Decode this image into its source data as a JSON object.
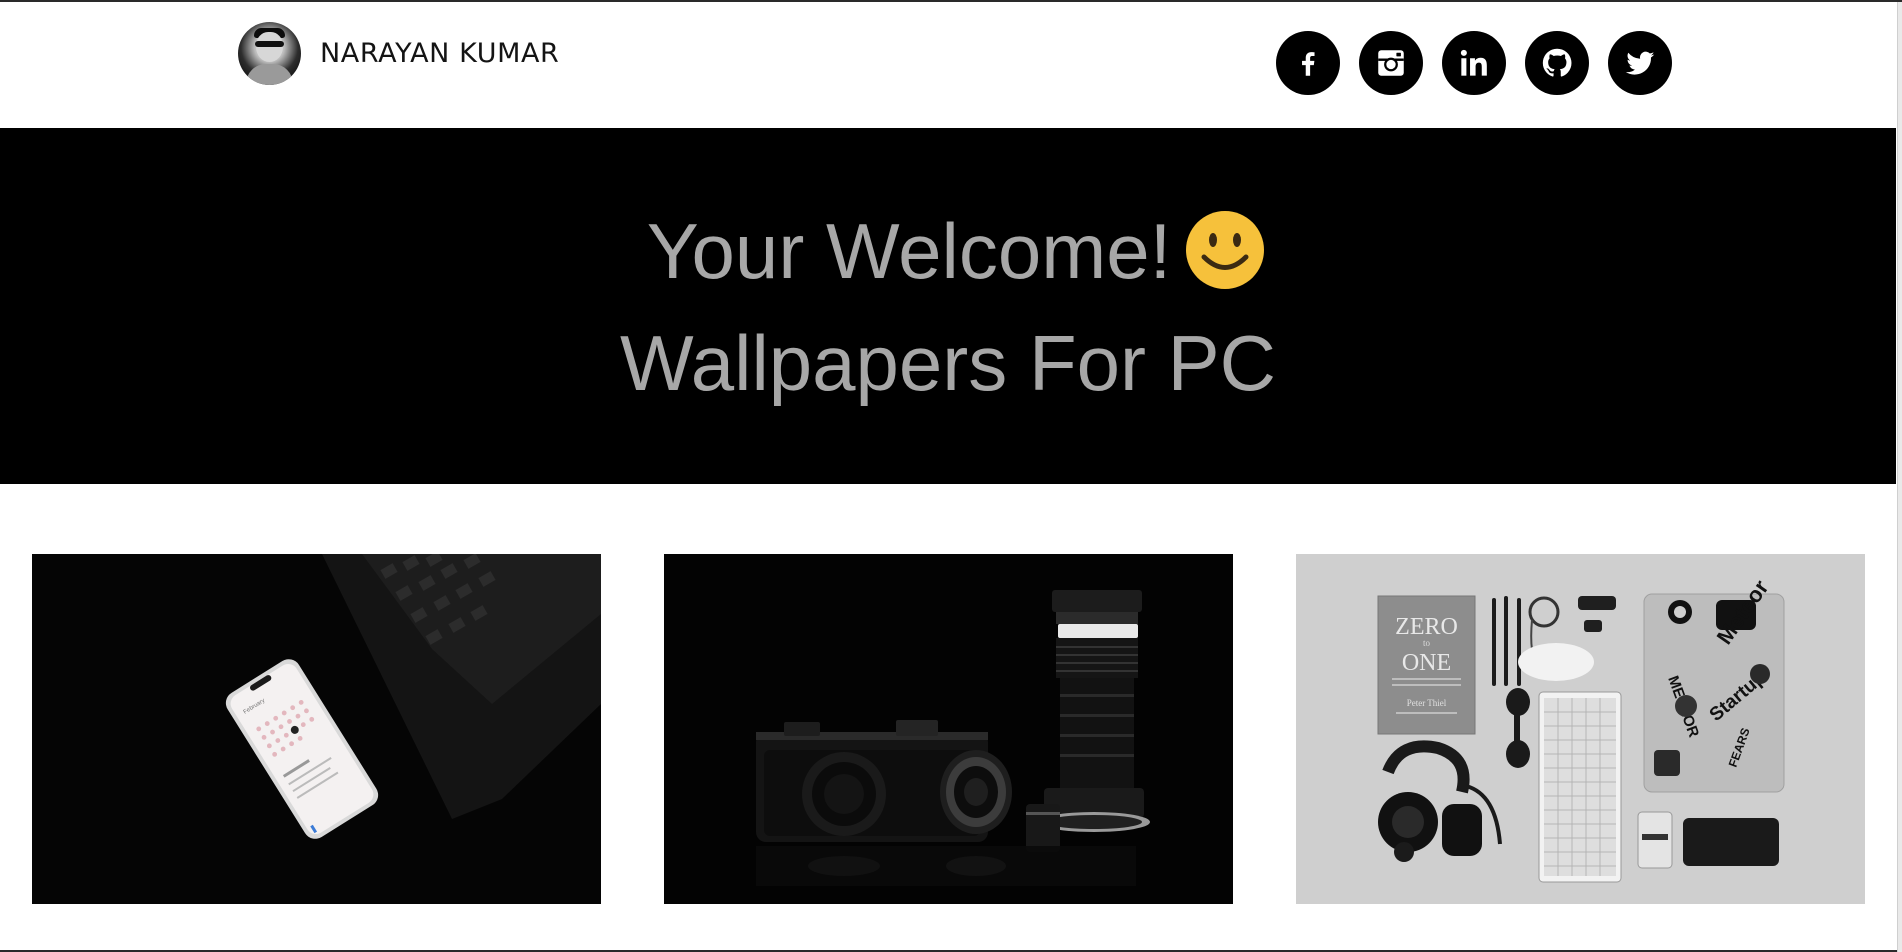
{
  "header": {
    "name": "NARAYAN KUMAR",
    "avatar_alt": "profile photo",
    "socials": [
      {
        "label": "facebook",
        "icon": "facebook-icon"
      },
      {
        "label": "instagram",
        "icon": "instagram-icon"
      },
      {
        "label": "linkedin",
        "icon": "linkedin-icon"
      },
      {
        "label": "github",
        "icon": "github-icon"
      },
      {
        "label": "twitter",
        "icon": "twitter-icon"
      }
    ]
  },
  "hero": {
    "line1": "Your Welcome!",
    "line2": "Wallpapers For PC",
    "emoji": "smiley-face-icon"
  },
  "gallery": {
    "items": [
      {
        "name": "wallpaper-phone-laptop",
        "subject": "phone on dark desk"
      },
      {
        "name": "wallpaper-camera-lens",
        "subject": "camera and lens"
      },
      {
        "name": "wallpaper-flatlay",
        "subject": "desk flat lay"
      }
    ],
    "book_title_1": "ZERO",
    "book_title_2": "to",
    "book_title_3": "ONE",
    "book_author": "Peter Thiel",
    "laptop_sticker_1": "Meteor",
    "laptop_sticker_2": "METEOR",
    "laptop_sticker_3": "Startup",
    "laptop_sticker_4": "FEARS"
  },
  "colors": {
    "hero_bg": "#000000",
    "hero_text": "#a7a7a7",
    "icon_bg": "#000000",
    "smiley": "#f6c13b"
  }
}
